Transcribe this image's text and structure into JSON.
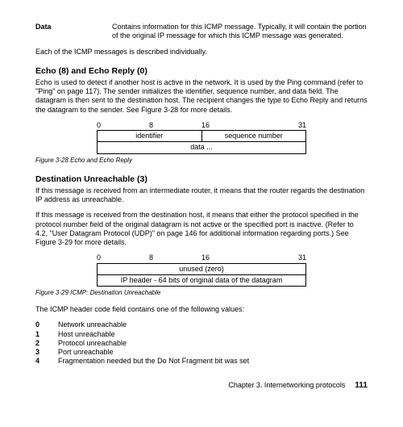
{
  "def": {
    "term": "Data",
    "body": "Contains information for this ICMP message. Typically, it will contain the portion of the original IP message for which this ICMP message was generated."
  },
  "intro": "Each of the ICMP messages is described individually.",
  "echo": {
    "heading": "Echo (8) and Echo Reply (0)",
    "body": "Echo is used to detect if another host is active in the network. It is used by the Ping command (refer to \"Ping\" on page 117). The sender initializes the identifier, sequence number, and data field. The datagram is then sent to the destination host. The recipient changes the type to Echo Reply and returns the datagram to the sender. See Figure 3-28 for more details.",
    "ticks": [
      "0",
      "8",
      "16",
      "31"
    ],
    "row1": [
      "identifier",
      "sequence number"
    ],
    "row2": "data ...",
    "caption": "Figure 3-28   Echo and Echo Reply"
  },
  "dest": {
    "heading": "Destination Unreachable (3)",
    "p1": "If this message is received from an intermediate router, it means that the router regards the destination IP address as unreachable.",
    "p2": "If this message is received from the destination host, it means that either the protocol specified in the protocol number field of the original datagram is not active or the specified port is inactive. (Refer to 4.2, \"User Datagram Protocol (UDP)\" on page 146 for additional information regarding ports.) See Figure 3-29 for more details.",
    "ticks": [
      "0",
      "8",
      "16",
      "31"
    ],
    "row1": "unused (zero)",
    "row2": "IP header - 64 bits of original data of the datagram",
    "caption": "Figure 3-29   ICMP: Destination Unreachable"
  },
  "codes": {
    "intro": "The ICMP header code field contains one of the following values:",
    "items": [
      {
        "n": "0",
        "t": "Network unreachable"
      },
      {
        "n": "1",
        "t": "Host unreachable"
      },
      {
        "n": "2",
        "t": "Protocol unreachable"
      },
      {
        "n": "3",
        "t": "Port unreachable"
      },
      {
        "n": "4",
        "t": "Fragmentation needed but the Do Not Fragment bit was set"
      }
    ]
  },
  "footer": {
    "chapter": "Chapter 3. Internetworking protocols",
    "page": "111"
  }
}
